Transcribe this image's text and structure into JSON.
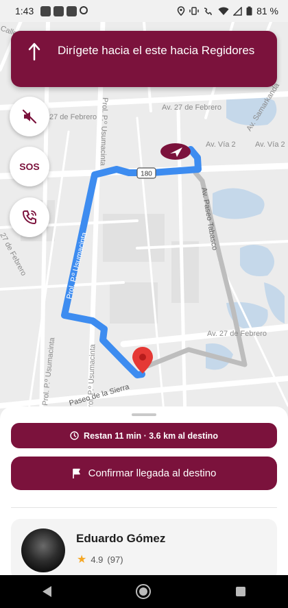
{
  "status_bar": {
    "time": "1:43",
    "battery": "81 %"
  },
  "colors": {
    "brand": "#7b123c",
    "route": "#3d8cf0",
    "alt_route": "#bdbdbd",
    "pin": "#e53935"
  },
  "map": {
    "labels": {
      "calle": "Calle",
      "febrero_1": "27 de Febrero",
      "febrero_2": "Av. 27 de Febrero",
      "febrero_3": "27 de Febrero",
      "febrero_4": "Av. 27 de Febrero",
      "samarkanda": "Av. Samarkanda",
      "via2_a": "Av. Vía 2",
      "via2_b": "Av. Vía 2",
      "usumacinta_top": "Prol. P.º Usumacinta",
      "usumacinta_route": "Prol. P.º Usumacinta",
      "usumacinta_left": "Prol. P.º Usumacinta",
      "usumacinta_bottom": "Prol. P.º Usumacinta",
      "tabasco": "Av. Paseo Tabasco",
      "sierra": "Paseo de la Sierra",
      "shield_180": "180"
    }
  },
  "banner": {
    "icon": "arrow-up-icon",
    "text": "Dirígete hacia el este hacia Regidores"
  },
  "fabs": [
    {
      "icon": "volume-mute-icon"
    },
    {
      "label": "SOS"
    },
    {
      "icon": "phone-call-icon"
    }
  ],
  "sheet": {
    "eta_icon": "clock-icon",
    "eta_text": "Restan 11 min · 3.6 km al destino",
    "confirm_icon": "flag-icon",
    "confirm_label": "Confirmar llegada al destino",
    "driver": {
      "name": "Eduardo Gómez",
      "rating": "4.9",
      "reviews": "(97)"
    }
  }
}
